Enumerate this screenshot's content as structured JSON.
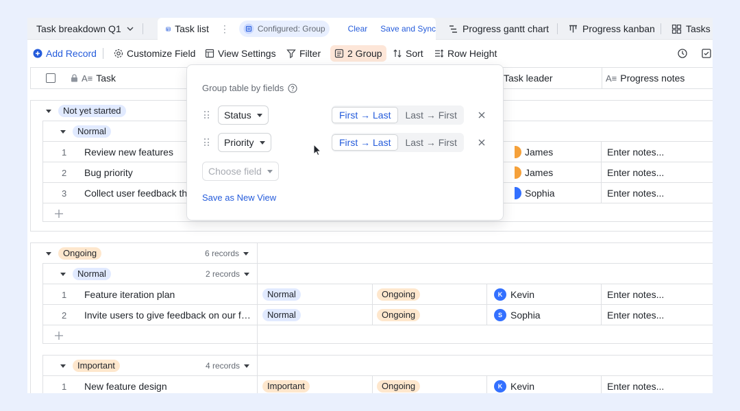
{
  "tabs": {
    "doc_title": "Task breakdown Q1",
    "task_list": "Task list",
    "configured": "Configured: Group",
    "clear": "Clear",
    "save_sync": "Save and Sync",
    "gantt": "Progress gantt chart",
    "kanban": "Progress kanban",
    "tasks": "Tasks"
  },
  "toolbar": {
    "add_record": "Add Record",
    "customize_field": "Customize Field",
    "view_settings": "View Settings",
    "filter": "Filter",
    "group": "2 Group",
    "sort": "Sort",
    "row_height": "Row Height"
  },
  "columns": {
    "task": "Task",
    "task_leader": "Task leader",
    "progress_notes": "Progress notes"
  },
  "group_popup": {
    "title": "Group table by fields",
    "rules": [
      {
        "field": "Status",
        "asc": "First → Last",
        "desc": "Last → First",
        "selected": "asc"
      },
      {
        "field": "Priority",
        "asc": "First → Last",
        "desc": "Last → First",
        "selected": "asc"
      }
    ],
    "choose_placeholder": "Choose field",
    "save_new_view": "Save as New View"
  },
  "groups": [
    {
      "label": "Not yet started",
      "subgroups": [
        {
          "label": "Normal",
          "rows": [
            {
              "num": "1",
              "task": "Review new features",
              "leader": "James",
              "notes": "Enter notes..."
            },
            {
              "num": "2",
              "task": "Bug priority",
              "leader": "James",
              "notes": "Enter notes..."
            },
            {
              "num": "3",
              "task": "Collect user feedback thr",
              "leader": "Sophia",
              "notes": "Enter notes..."
            }
          ]
        }
      ]
    },
    {
      "label": "Ongoing",
      "count": "6 records",
      "subgroups": [
        {
          "label": "Normal",
          "count": "2 records",
          "rows": [
            {
              "num": "1",
              "task": "Feature iteration plan",
              "priority": "Normal",
              "status": "Ongoing",
              "avatar": "K",
              "leader": "Kevin",
              "notes": "Enter notes..."
            },
            {
              "num": "2",
              "task": "Invite users to give feedback on our for...",
              "priority": "Normal",
              "status": "Ongoing",
              "avatar": "S",
              "leader": "Sophia",
              "notes": "Enter notes..."
            }
          ]
        },
        {
          "label": "Important",
          "count": "4 records",
          "rows": [
            {
              "num": "1",
              "task": "New feature design",
              "priority": "Important",
              "status": "Ongoing",
              "avatar": "K",
              "leader": "Kevin",
              "notes": "Enter notes..."
            }
          ]
        }
      ]
    }
  ],
  "colors": {
    "accent": "#245bdb",
    "background": "#eaf0fd",
    "avatar_orange": "#f5a13a",
    "avatar_blue": "#3370ff"
  }
}
